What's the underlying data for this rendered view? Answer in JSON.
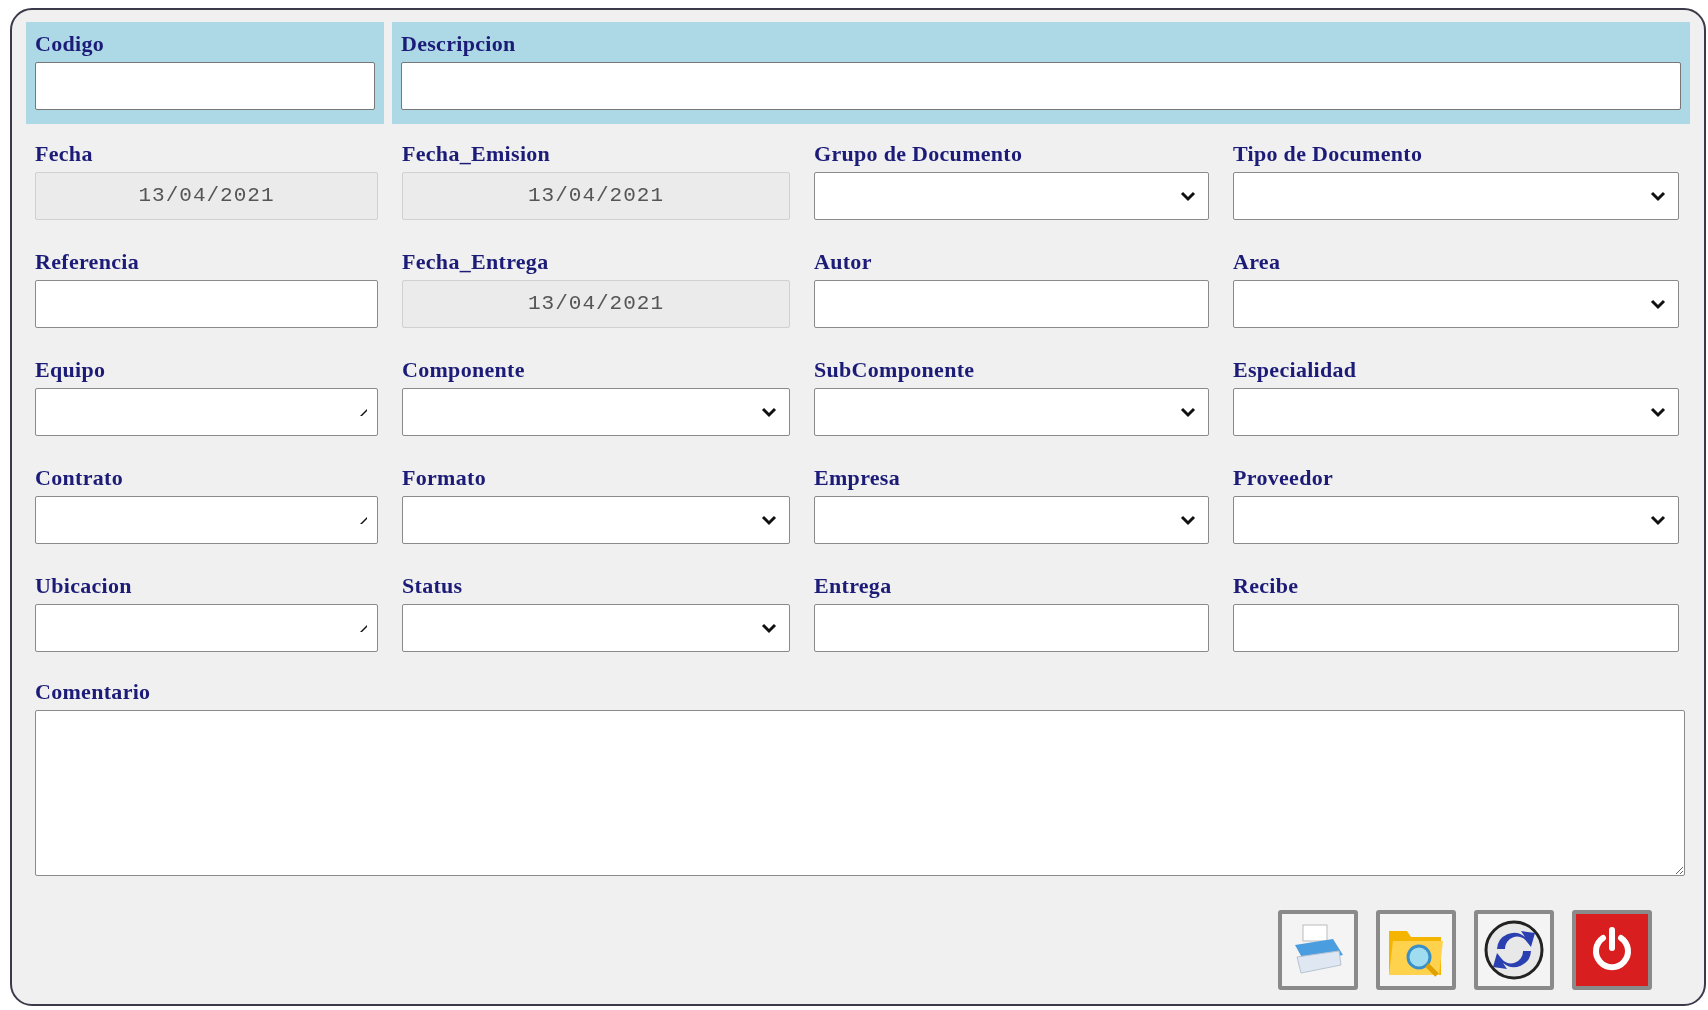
{
  "header_fields": [
    {
      "label": "Codigo"
    },
    {
      "label": "Descripcion"
    }
  ],
  "fields": [
    {
      "label": "Fecha",
      "kind": "date",
      "value": "13/04/2021",
      "disabled": true
    },
    {
      "label": "Fecha_Emision",
      "kind": "date",
      "value": "13/04/2021",
      "disabled": true
    },
    {
      "label": "Grupo de Documento",
      "kind": "select"
    },
    {
      "label": "Tipo de Documento",
      "kind": "select"
    },
    {
      "label": "Referencia",
      "kind": "text"
    },
    {
      "label": "Fecha_Entrega",
      "kind": "date",
      "value": "13/04/2021",
      "disabled": true
    },
    {
      "label": "Autor",
      "kind": "text"
    },
    {
      "label": "Area",
      "kind": "select"
    },
    {
      "label": "Equipo",
      "kind": "combo"
    },
    {
      "label": "Componente",
      "kind": "select"
    },
    {
      "label": "SubComponente",
      "kind": "select"
    },
    {
      "label": "Especialidad",
      "kind": "select"
    },
    {
      "label": "Contrato",
      "kind": "combo"
    },
    {
      "label": "Formato",
      "kind": "select"
    },
    {
      "label": "Empresa",
      "kind": "select"
    },
    {
      "label": "Proveedor",
      "kind": "select"
    },
    {
      "label": "Ubicacion",
      "kind": "combo"
    },
    {
      "label": "Status",
      "kind": "select"
    },
    {
      "label": "Entrega",
      "kind": "text"
    },
    {
      "label": "Recibe",
      "kind": "text"
    }
  ],
  "comment": {
    "label": "Comentario"
  }
}
